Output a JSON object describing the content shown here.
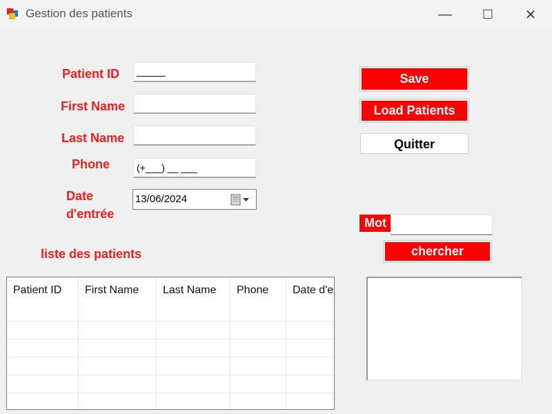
{
  "window": {
    "title": "Gestion des patients",
    "minimize_glyph": "—",
    "maximize_glyph": "☐",
    "close_glyph": "✕"
  },
  "form": {
    "patient_id_label": "Patient ID",
    "patient_id_value": "_____",
    "first_name_label": "First Name",
    "first_name_value": "",
    "last_name_label": "Last Name",
    "last_name_value": "",
    "phone_label": "Phone",
    "phone_value": "(+___) __ ___",
    "date_label_line1": "Date",
    "date_label_line2": "d'entrée",
    "date_value": "13/06/2024"
  },
  "buttons": {
    "save": "Save",
    "load": "Load Patients",
    "quit": "Quitter",
    "search": "chercher"
  },
  "search": {
    "label": "Mot",
    "value": ""
  },
  "list": {
    "title": "liste des patients",
    "columns": [
      "Patient ID",
      "First Name",
      "Last Name",
      "Phone",
      "Date d'en"
    ]
  },
  "colors": {
    "accent": "#ff0000",
    "label": "#f21d1d"
  }
}
